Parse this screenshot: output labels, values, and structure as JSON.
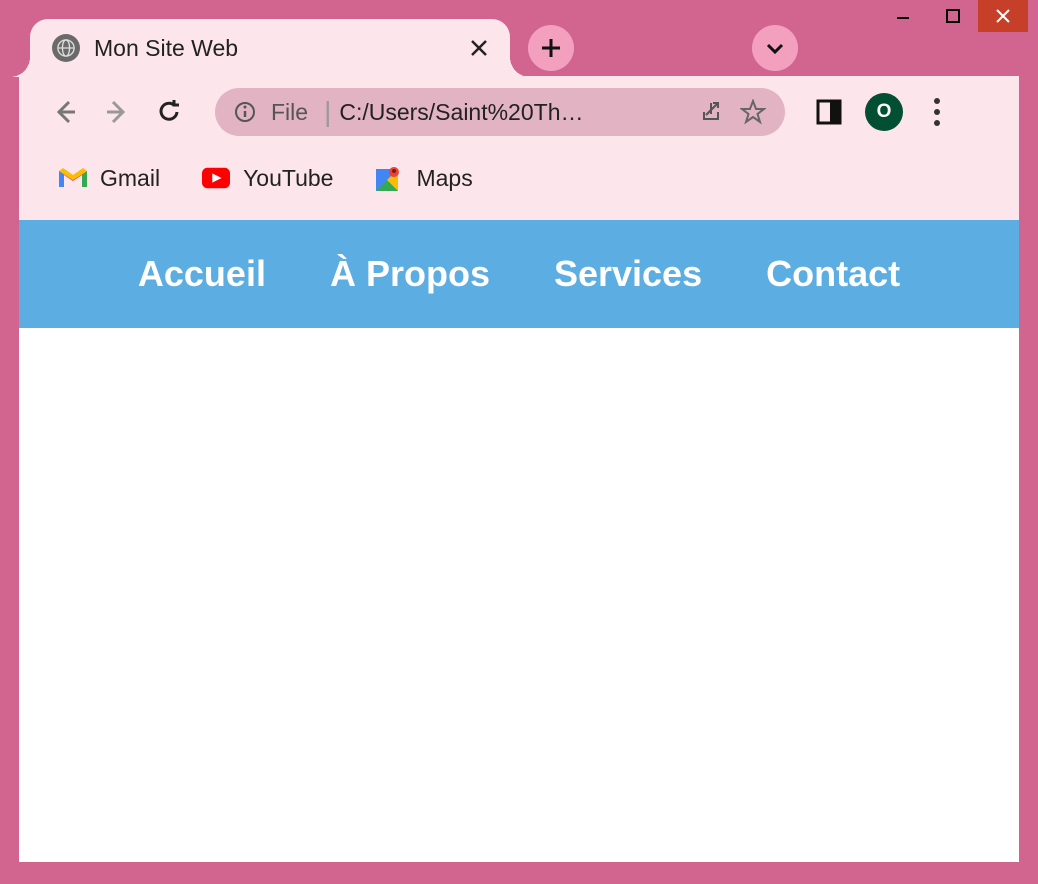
{
  "browser": {
    "tab": {
      "title": "Mon Site Web"
    },
    "address": {
      "scheme_label": "File",
      "url": "C:/Users/Saint%20Th…"
    },
    "avatar_initial": "O",
    "bookmarks": [
      {
        "label": "Gmail",
        "icon": "gmail"
      },
      {
        "label": "YouTube",
        "icon": "youtube"
      },
      {
        "label": "Maps",
        "icon": "maps"
      }
    ]
  },
  "site": {
    "nav": [
      {
        "label": "Accueil"
      },
      {
        "label": "À Propos"
      },
      {
        "label": "Services"
      },
      {
        "label": "Contact"
      }
    ]
  },
  "colors": {
    "browser_frame": "#d16590",
    "tab_bg": "#fce6ec",
    "circle_btn": "#f3a0be",
    "addressbar": "#e2b3c3",
    "site_nav": "#5cade2",
    "avatar_bg": "#024f33"
  }
}
